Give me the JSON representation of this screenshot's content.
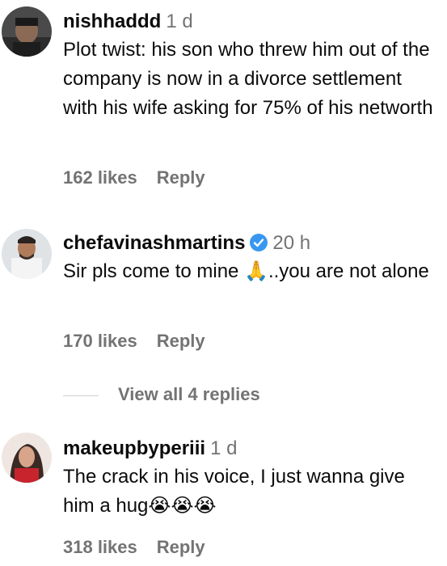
{
  "comments": [
    {
      "username": "nishhaddd",
      "time": "1 d",
      "verified": false,
      "text": "Plot twist: his son who threw him out of the company is now in a divorce settlement with his wife asking for 75% of his networth",
      "likes": "162 likes",
      "reply": "Reply"
    },
    {
      "username": "chefavinashmartins",
      "time": "20 h",
      "verified": true,
      "text": "Sir pls come to mine 🙏..you are not alone",
      "likes": "170 likes",
      "reply": "Reply"
    },
    {
      "username": "makeupbyperiii",
      "time": "1 d",
      "verified": false,
      "text": "The crack in his voice, I just wanna give him a hug😭😭😭",
      "likes": "318 likes",
      "reply": "Reply"
    }
  ],
  "view_replies": "View all 4 replies",
  "colors": {
    "secondary": "#737373",
    "verified": "#3897f0"
  }
}
